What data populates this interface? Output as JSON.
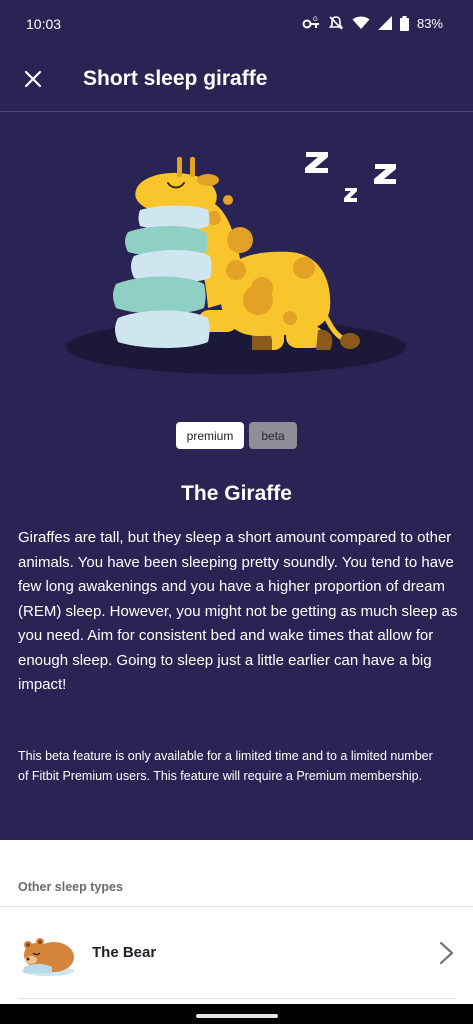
{
  "status_bar": {
    "time": "10:03",
    "battery": "83%",
    "icons": [
      "vpn-key-icon",
      "alarm-off-icon",
      "wifi-icon",
      "signal-icon",
      "battery-icon"
    ]
  },
  "header": {
    "title": "Short sleep giraffe",
    "close_icon": "close-icon"
  },
  "badges": {
    "premium": "premium",
    "beta": "beta"
  },
  "animal": {
    "title": "The Giraffe",
    "description": "Giraffes are tall, but they sleep a short amount compared to other animals. You have been sleeping pretty soundly. You tend to have few long awakenings and you have a higher proportion of dream (REM) sleep. However, you might not be getting as much sleep as you need. Aim for consistent bed and wake times that allow for enough sleep. Going to sleep just a little earlier can have a big impact!"
  },
  "beta_note": "This beta feature is only available for a limited time and to a limited number of Fitbit Premium users. This feature will require a Premium membership.",
  "other_sleep_types": {
    "heading": "Other sleep types",
    "items": [
      {
        "label": "The Bear",
        "icon": "bear-icon"
      }
    ]
  },
  "colors": {
    "background": "#2a2454",
    "giraffe": "#f8c62c",
    "spots": "#e3a126",
    "pillow_blue": "#cfe6f1",
    "pillow_teal": "#8fd0c4",
    "shadow": "#1c1838"
  }
}
